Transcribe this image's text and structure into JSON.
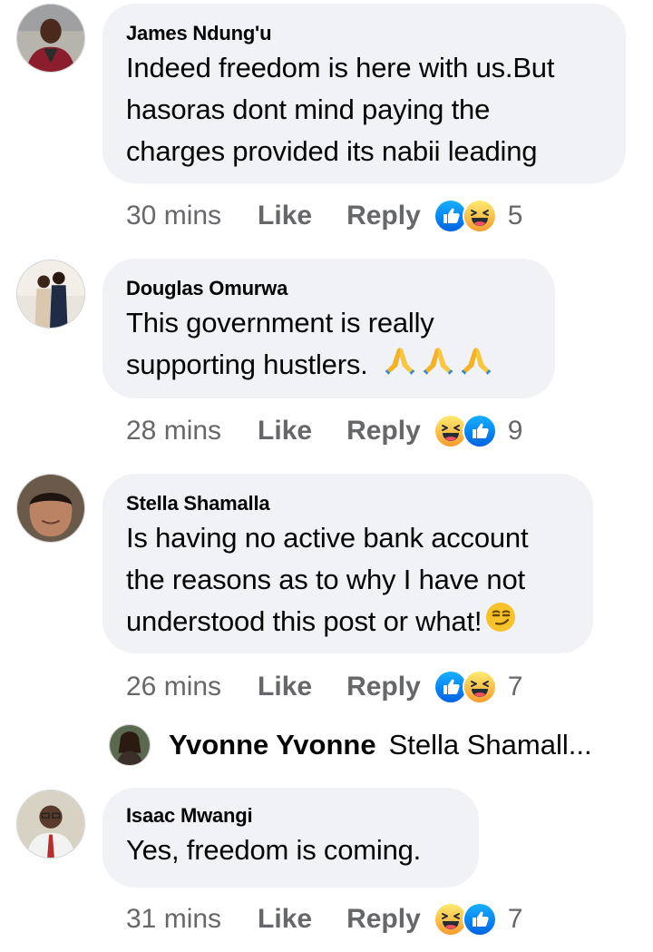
{
  "comments": [
    {
      "author": "James Ndung'u",
      "lines": [
        "Indeed freedom is here with us.But",
        "hasoras dont mind paying the",
        "charges provided its nabii leading"
      ],
      "time": "30 mins",
      "like": "Like",
      "reply": "Reply",
      "reactions": [
        "like-reaction-icon",
        "haha-reaction-icon"
      ],
      "count": "5"
    },
    {
      "author": "Douglas Omurwa",
      "lines": [
        "This government is really",
        "supporting hustlers."
      ],
      "emoji_trailing": [
        "folded-hands-emoji",
        "folded-hands-emoji",
        "folded-hands-emoji"
      ],
      "time": "28 mins",
      "like": "Like",
      "reply": "Reply",
      "reactions": [
        "haha-reaction-icon",
        "like-reaction-icon"
      ],
      "count": "9"
    },
    {
      "author": "Stella Shamalla",
      "lines": [
        "Is having no active bank account",
        "the reasons as to why I have not",
        "understood this post or what!"
      ],
      "emoji_trailing": [
        "smirking-face-emoji"
      ],
      "time": "26 mins",
      "like": "Like",
      "reply": "Reply",
      "reactions": [
        "like-reaction-icon",
        "haha-reaction-icon"
      ],
      "count": "7"
    },
    {
      "author": "Isaac Mwangi",
      "lines": [
        "Yes, freedom is coming."
      ],
      "time": "31 mins",
      "like": "Like",
      "reply": "Reply",
      "reactions": [
        "haha-reaction-icon",
        "like-reaction-icon"
      ],
      "count": "7"
    }
  ],
  "nested_reply": {
    "author": "Yvonne Yvonne",
    "snippet": "Stella Shamall..."
  },
  "colors": {
    "bubble": "#f0f2f5",
    "meta_text": "#65676b",
    "like_blue": "#1877f2",
    "haha_yellow": "#f7b125"
  }
}
